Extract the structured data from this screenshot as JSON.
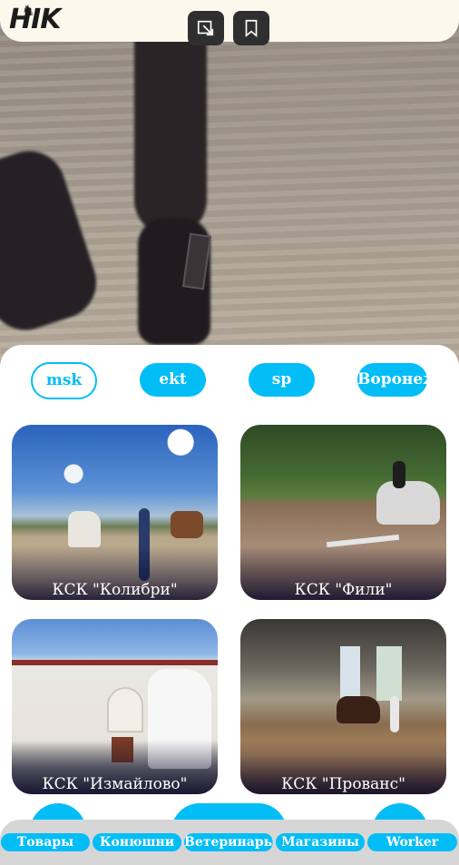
{
  "header": {
    "logo_text": "HIK",
    "share_icon": "share-arrow-icon",
    "bookmark_icon": "bookmark-icon"
  },
  "cities": [
    {
      "label": "msk",
      "selected": true
    },
    {
      "label": "ekt",
      "selected": false
    },
    {
      "label": "sp",
      "selected": false
    },
    {
      "label": "Воронеж",
      "selected": false
    }
  ],
  "stables": [
    {
      "name": "КСК \"Колибри\""
    },
    {
      "name": "КСК \"Фили\""
    },
    {
      "name": "КСК \"Измайлово\""
    },
    {
      "name": "КСК \"Прованс\""
    }
  ],
  "bottom_nav": {
    "items": [
      {
        "label": "Товары"
      },
      {
        "label": "Конюшни"
      },
      {
        "label": "Ветеринары"
      },
      {
        "label": "Магазины"
      },
      {
        "label": "Worker"
      }
    ]
  },
  "colors": {
    "accent": "#03bdf7",
    "header_bg": "#fdf8ec",
    "nav_bg": "#d6d6d6",
    "icon_button_bg": "#2f2f2f"
  }
}
